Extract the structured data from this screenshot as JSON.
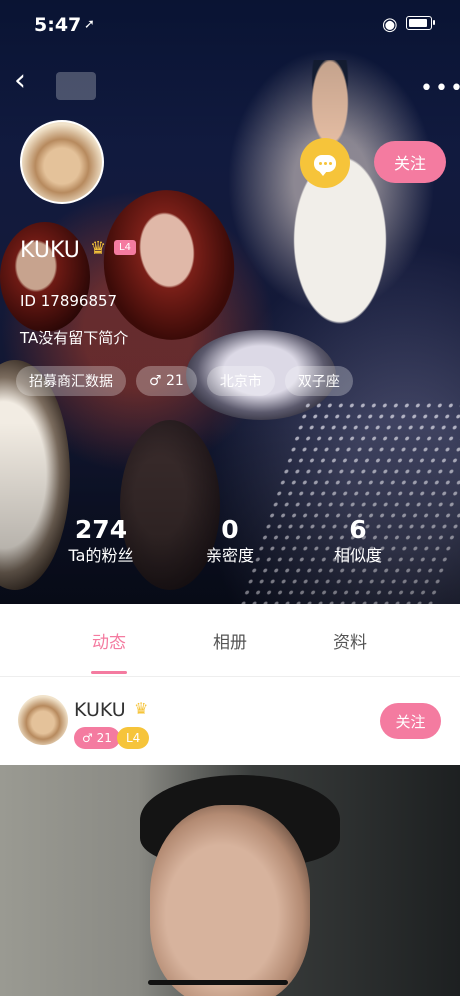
{
  "status_bar": {
    "time": "5:47",
    "location_icon": "location-arrow-icon",
    "wifi_icon": "wifi-icon",
    "battery_icon": "battery-icon"
  },
  "nav": {
    "back_icon": "chevron-left-icon",
    "more_icon": "more-dots-icon",
    "more_glyph": "•••"
  },
  "profile": {
    "name": "KUKU",
    "level_badge": "L4",
    "id_text": "ID 17896857",
    "intro": "TA没有留下简介",
    "tags": [
      "招募商汇数据",
      "♂ 21",
      "北京市",
      "双子座"
    ],
    "follow_label": "关注",
    "chat_icon": "chat-bubble-icon"
  },
  "stats": [
    {
      "value": "274",
      "label": "Ta的粉丝"
    },
    {
      "value": "0",
      "label": "亲密度"
    },
    {
      "value": "6",
      "label": "相似度"
    }
  ],
  "tabs": {
    "items": [
      "动态",
      "相册",
      "资料"
    ],
    "active": 0
  },
  "post": {
    "author": "KUKU",
    "gender_age": "♂ 21",
    "level": "L4",
    "follow_label": "关注"
  },
  "colors": {
    "accent_pink": "#f47ba0",
    "gold": "#f6c43a"
  }
}
